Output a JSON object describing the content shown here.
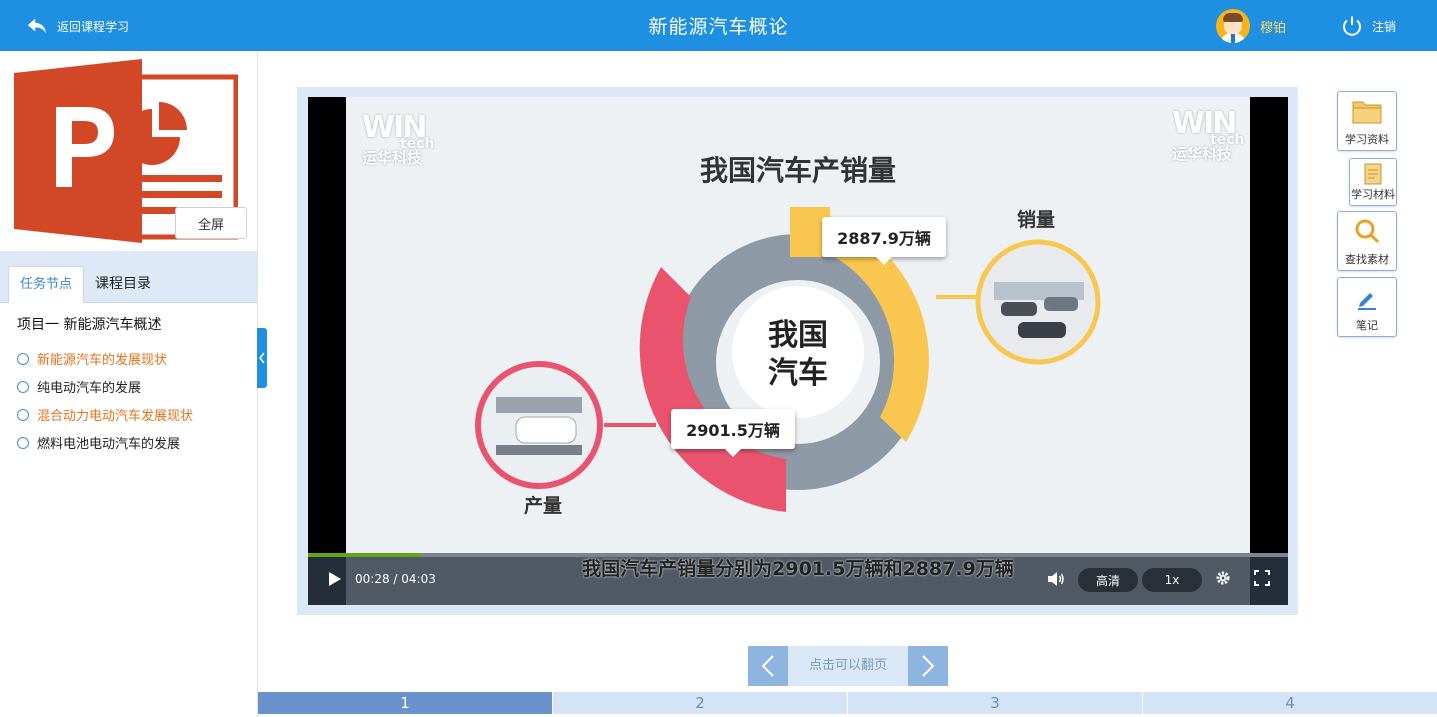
{
  "header": {
    "back_label": "返回课程学习",
    "title": "新能源汽车概论",
    "user_name": "穆铂",
    "logout_label": "注销"
  },
  "sidebar": {
    "fullscreen_label": "全屏",
    "tabs": [
      {
        "label": "任务节点",
        "active": true
      },
      {
        "label": "课程目录",
        "active": false
      }
    ],
    "project_title": "项目一 新能源汽车概述",
    "tasks": [
      {
        "label": "新能源汽车的发展现状",
        "color": "#e8721c"
      },
      {
        "label": "纯电动汽车的发展",
        "color": "#222222"
      },
      {
        "label": "混合动力电动汽车发展现状",
        "color": "#e8721c"
      },
      {
        "label": "燃料电池电动汽车的发展",
        "color": "#222222"
      }
    ]
  },
  "video": {
    "brand_top": "WIN",
    "brand_tech": "tech",
    "brand_cn": "运华科技",
    "slide_title": "我国汽车产销量",
    "center_line1": "我国",
    "center_line2": "汽车",
    "sales_value": "2887.9万辆",
    "sales_label": "销量",
    "production_value": "2901.5万辆",
    "production_label": "产量",
    "subtitle": "我国汽车产销量分别为2901.5万辆和2887.9万辆",
    "time": "00:28 / 04:03",
    "progress_fraction": 0.1152,
    "quality_label": "高清",
    "speed_label": "1x",
    "colors": {
      "production": "#e9536e",
      "sales": "#f9c74f",
      "ring": "#8e99a6"
    }
  },
  "tools": {
    "materials": "学习资料",
    "study_materials": "学习材料",
    "search_assets": "查找素材",
    "notes": "笔记"
  },
  "pager": {
    "hint": "点击可以翻页",
    "pages": [
      "1",
      "2",
      "3",
      "4"
    ],
    "active_index": 0
  }
}
